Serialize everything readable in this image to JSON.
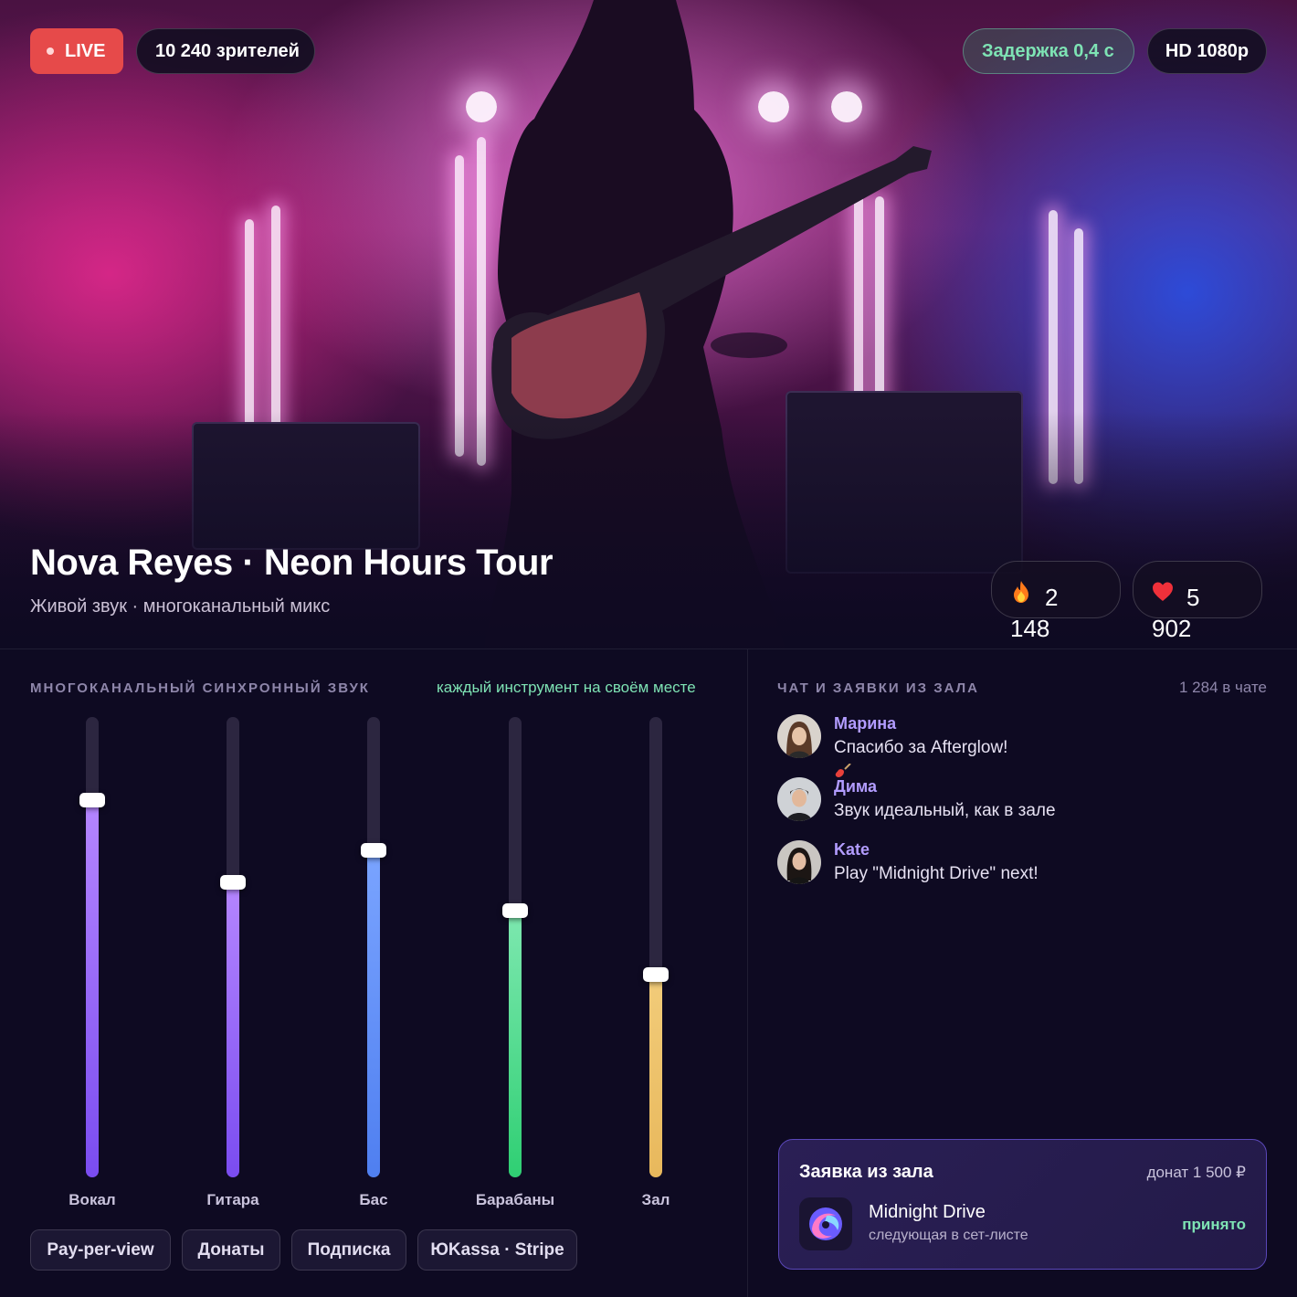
{
  "hero": {
    "live_label": "LIVE",
    "viewers": "10 240 зрителей",
    "latency": "Задержка 0,4 с",
    "quality": "HD 1080p",
    "title": "Nova Reyes · Neon Hours Tour",
    "subtitle": "Живой звук · многоканальный микс",
    "reactions": [
      {
        "icon": "fire-icon",
        "count": "2 148"
      },
      {
        "icon": "heart-icon",
        "count": "5 902"
      }
    ]
  },
  "mixer": {
    "label": "Многоканальный синхронный звук",
    "note": "каждый инструмент на своём месте",
    "channels": [
      {
        "name": "Вокал",
        "level": 0.82,
        "color_top": "#b586ff",
        "color_bottom": "#7a4cf0"
      },
      {
        "name": "Гитара",
        "level": 0.64,
        "color_top": "#b586ff",
        "color_bottom": "#7a4cf0"
      },
      {
        "name": "Бас",
        "level": 0.71,
        "color_top": "#7aa4ff",
        "color_bottom": "#4f7ff0"
      },
      {
        "name": "Барабаны",
        "level": 0.58,
        "color_top": "#7ee8b0",
        "color_bottom": "#2fcf73"
      },
      {
        "name": "Зал",
        "level": 0.44,
        "color_top": "#f2cc7a",
        "color_bottom": "#e8b85c"
      }
    ]
  },
  "payments": {
    "tags": [
      "Pay-per-view",
      "Донаты",
      "Подписка",
      "ЮKassa · Stripe"
    ]
  },
  "chat": {
    "label": "Чат и заявки из зала",
    "count": "1 284 в чате",
    "messages": [
      {
        "name": "Марина",
        "text": "Спасибо за Afterglow!"
      },
      {
        "name": "Дима",
        "text": "Звук идеальный, как в зале"
      },
      {
        "name": "Kate",
        "text": "Play \"Midnight Drive\" next!"
      }
    ]
  },
  "request": {
    "title": "Заявка из зала",
    "donation": "донат 1 500 ₽",
    "song": "Midnight Drive",
    "note": "следующая в сет-листе",
    "status": "принято"
  },
  "colors": {
    "accent": "#7ee3b4",
    "live": "#e64a4a",
    "name": "#b29cff",
    "background": "#0e0a22"
  }
}
